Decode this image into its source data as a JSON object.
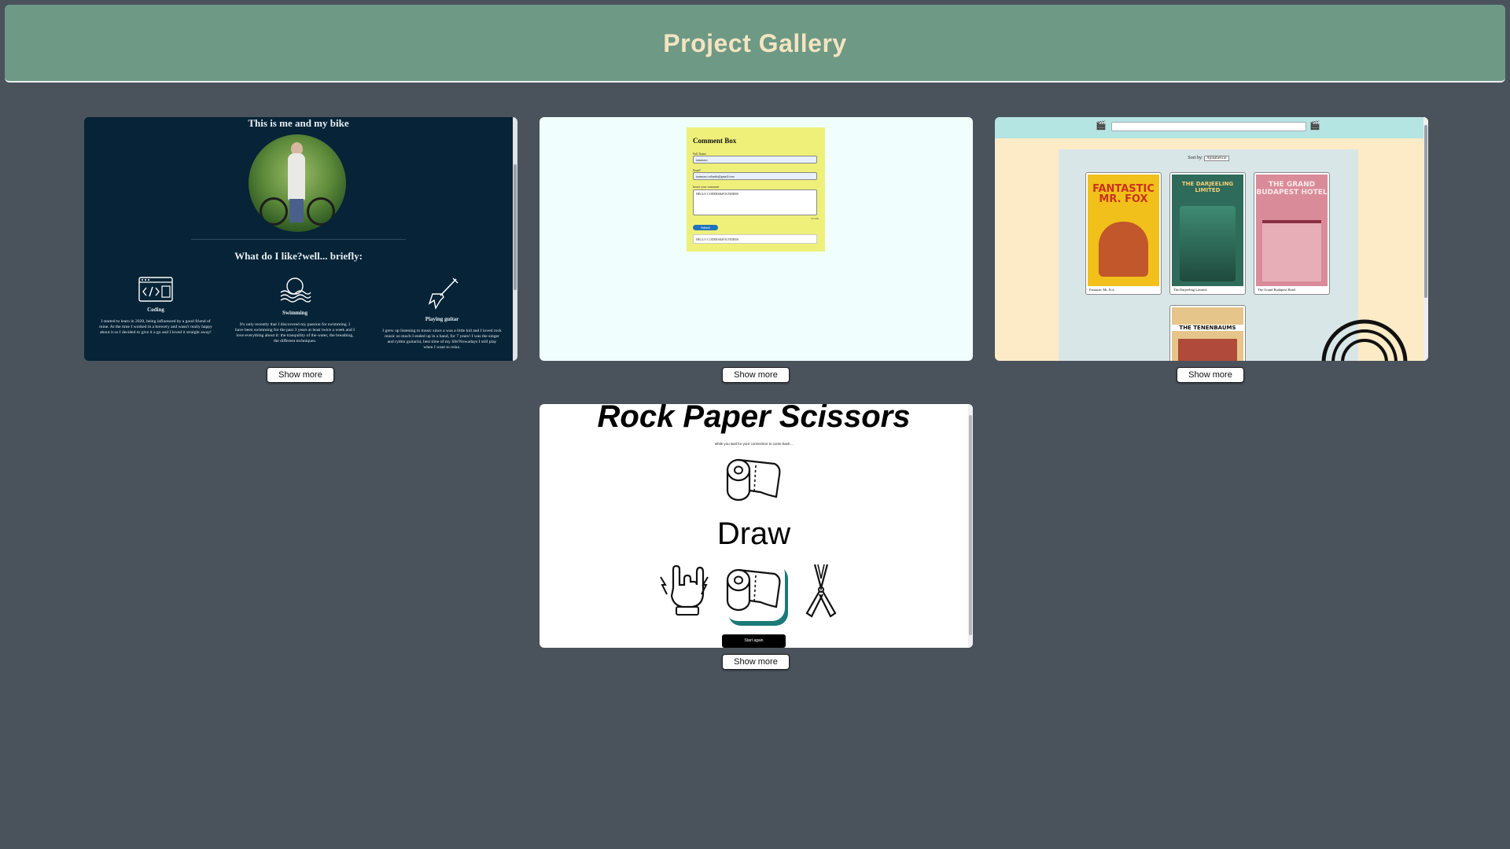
{
  "page": {
    "title": "Project Gallery",
    "background": "#4a525c",
    "header_color": "#6e9985",
    "title_color": "#f4e4c1"
  },
  "show_more_label": "Show more",
  "cards": [
    {
      "name": "about-me",
      "title": "This is me and my bike",
      "subtitle": "What do I like?well... briefly:",
      "hobbies": [
        {
          "title": "Coding",
          "icon": "code-window-icon",
          "text": "I started to learn in 2020, being influenced by a good friend of mine. At the time I worked in a brewery and wasn't really happy about it so I decided to give it a go and I loved it straight away!"
        },
        {
          "title": "Swimming",
          "icon": "waves-icon",
          "text": "It's only recently that I discovered my passion for swimming. I have been swimming for the past 3 years at least twice a week and I love everything about it: the tranquility of the water, the breathing, the different techniques."
        },
        {
          "title": "Playing guitar",
          "icon": "guitar-icon",
          "text": "I grew up listening to music since a was a little kid and I loved rock music so much I ended up in a band, for 7 years! I was the singer and rythm guitarist, best time of my life!Nowadays I still play when I want to relax."
        }
      ]
    },
    {
      "name": "comment-box",
      "title": "Comment Box",
      "full_name_label": "Full Name",
      "full_name_value": "tommaso",
      "email_label": "Email",
      "email_value": "tommaso.orlando@gmail.com",
      "comment_label": "Insert your comment",
      "comment_value": "HELLO CODERS&FOUNDERS",
      "counter": "21/140",
      "submit_label": "Submit",
      "posted_comment": "HELLO CODERS&FOUNDERS"
    },
    {
      "name": "movie-list",
      "sort_label": "Sort by:",
      "sort_value": "Alphabetical",
      "movies": [
        {
          "title": "Fantastic Mr. Fox",
          "poster_text": "FANTASTIC MR. FOX",
          "poster_color": "#f2c01a"
        },
        {
          "title": "The Darjeeling Limited",
          "poster_text": "THE DARJEELING LIMITED",
          "poster_color": "#2f6b5a"
        },
        {
          "title": "The Grand Budapest Hotel",
          "poster_text": "THE GRAND BUDAPEST HOTEL",
          "poster_color": "#d98b9a"
        },
        {
          "title": "",
          "poster_text": "THE TENENBAUMS",
          "poster_color": "#e6c58a"
        }
      ]
    },
    {
      "name": "rock-paper-scissors",
      "title": "Rock Paper Scissors",
      "note": "while you wait for your connection to come back...",
      "result": "Draw",
      "choices": [
        "rock-hand-icon",
        "paper-roll-icon",
        "scissors-icon"
      ],
      "selected": "paper-roll-icon",
      "accent": "#1a7a78",
      "restart_label": "Start again"
    }
  ]
}
